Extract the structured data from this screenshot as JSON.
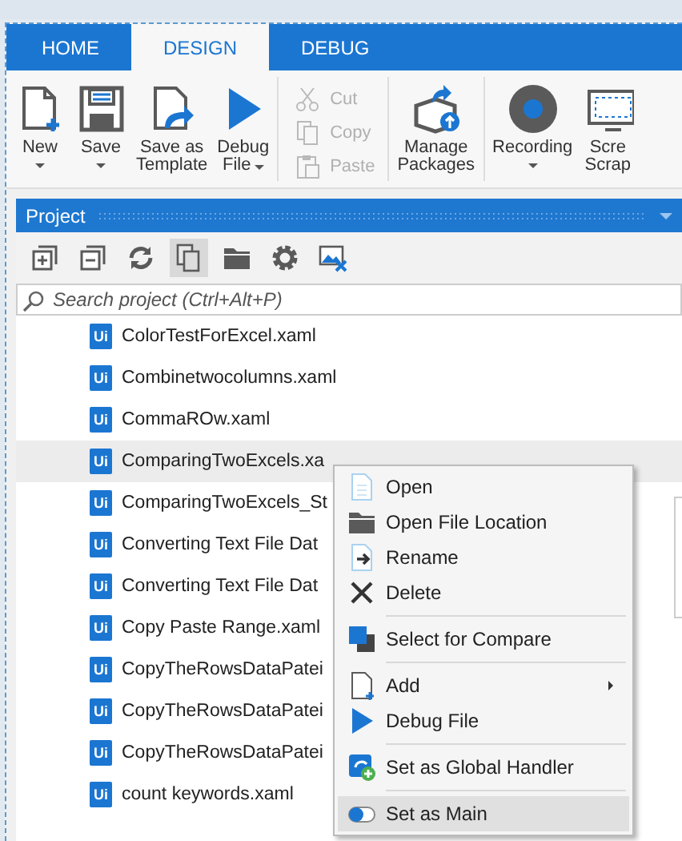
{
  "tabs": [
    {
      "label": "HOME",
      "selected": false
    },
    {
      "label": "DESIGN",
      "selected": true
    },
    {
      "label": "DEBUG",
      "selected": false
    }
  ],
  "ribbon": {
    "groups": [
      {
        "kind": "large",
        "buttons": [
          {
            "kind": "new",
            "lines": [
              "New"
            ],
            "dropdown": true
          },
          {
            "kind": "save",
            "lines": [
              "Save"
            ],
            "dropdown": true
          },
          {
            "kind": "template",
            "lines": [
              "Save as",
              "Template"
            ],
            "dropdown": false
          },
          {
            "kind": "debug",
            "lines": [
              "Debug",
              "File"
            ],
            "dropdown": true
          }
        ]
      },
      {
        "kind": "small",
        "buttons": [
          {
            "kind": "cut",
            "lines": [
              "Cut"
            ],
            "disabled": true
          },
          {
            "kind": "copy",
            "lines": [
              "Copy"
            ],
            "disabled": true
          },
          {
            "kind": "paste",
            "lines": [
              "Paste"
            ],
            "disabled": true
          }
        ]
      },
      {
        "kind": "large",
        "buttons": [
          {
            "kind": "packages",
            "lines": [
              "Manage",
              "Packages"
            ],
            "dropdown": false
          }
        ]
      },
      {
        "kind": "large",
        "buttons": [
          {
            "kind": "recording",
            "lines": [
              "Recording"
            ],
            "dropdown": true
          },
          {
            "kind": "screen",
            "lines": [
              "Scre",
              "Scrap"
            ],
            "dropdown": false
          }
        ]
      }
    ]
  },
  "panel": {
    "title": "Project",
    "tools": [
      {
        "kind": "expand",
        "selected": false
      },
      {
        "kind": "collapse",
        "selected": false
      },
      {
        "kind": "refresh",
        "selected": false
      },
      {
        "kind": "copies",
        "selected": true
      },
      {
        "kind": "folder",
        "selected": false
      },
      {
        "kind": "settings",
        "selected": false
      },
      {
        "kind": "image",
        "selected": false
      }
    ],
    "search": {
      "placeholder": "Search project (Ctrl+Alt+P)"
    },
    "files": [
      {
        "badge": "Ui",
        "label": "ColorTestForExcel.xaml",
        "selected": false
      },
      {
        "badge": "Ui",
        "label": "Combinetwocolumns.xaml",
        "selected": false
      },
      {
        "badge": "Ui",
        "label": "CommaROw.xaml",
        "selected": false
      },
      {
        "badge": "Ui",
        "label": "ComparingTwoExcels.xa",
        "selected": true
      },
      {
        "badge": "Ui",
        "label": "ComparingTwoExcels_St",
        "selected": false
      },
      {
        "badge": "Ui",
        "label": "Converting Text File Dat",
        "selected": false
      },
      {
        "badge": "Ui",
        "label": "Converting Text File Dat",
        "selected": false
      },
      {
        "badge": "Ui",
        "label": "Copy Paste Range.xaml",
        "selected": false
      },
      {
        "badge": "Ui",
        "label": "CopyTheRowsDataPatei",
        "selected": false
      },
      {
        "badge": "Ui",
        "label": "CopyTheRowsDataPatei",
        "selected": false
      },
      {
        "badge": "Ui",
        "label": "CopyTheRowsDataPatei",
        "selected": false
      },
      {
        "badge": "Ui",
        "label": "count keywords.xaml",
        "selected": false
      }
    ]
  },
  "context_menu": [
    {
      "kind": "open",
      "label": "Open",
      "highlighted": false
    },
    {
      "kind": "folder",
      "label": "Open File Location",
      "highlighted": false
    },
    {
      "kind": "rename",
      "label": "Rename",
      "highlighted": false
    },
    {
      "kind": "delete",
      "label": "Delete",
      "highlighted": false
    },
    {
      "kind": "separator"
    },
    {
      "kind": "compare",
      "label": "Select for Compare",
      "highlighted": false
    },
    {
      "kind": "separator"
    },
    {
      "kind": "add",
      "label": "Add",
      "highlighted": false,
      "submenu": true
    },
    {
      "kind": "debug",
      "label": "Debug File",
      "highlighted": false
    },
    {
      "kind": "separator"
    },
    {
      "kind": "handler",
      "label": "Set as Global Handler",
      "highlighted": false
    },
    {
      "kind": "separator"
    },
    {
      "kind": "main",
      "label": "Set as Main",
      "highlighted": true
    }
  ]
}
